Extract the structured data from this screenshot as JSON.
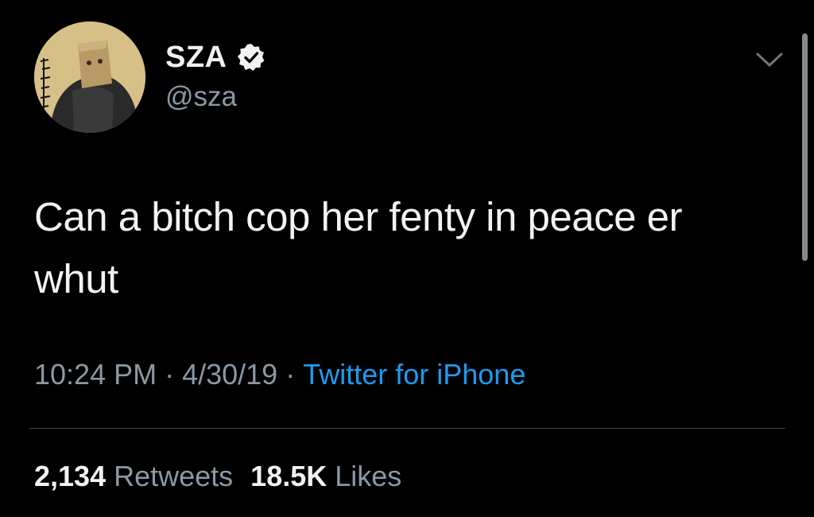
{
  "tweet": {
    "author": {
      "display_name": "SZA",
      "handle": "@sza",
      "verified": true,
      "avatar_icon": "profile-avatar"
    },
    "text_lines": [
      "Can a bitch cop her fenty in peace er",
      "whut"
    ],
    "time": "10:24 PM",
    "date": "4/30/19",
    "separator": "·",
    "source": "Twitter for iPhone",
    "stats": {
      "retweets_count": "2,134",
      "retweets_label": "Retweets",
      "likes_count": "18.5K",
      "likes_label": "Likes"
    },
    "menu_icon": "chevron-down-icon"
  },
  "colors": {
    "background": "#000000",
    "text_primary": "#f2f2f2",
    "text_secondary": "#8b98a5",
    "link": "#1d9bf0",
    "divider": "#38444d"
  }
}
